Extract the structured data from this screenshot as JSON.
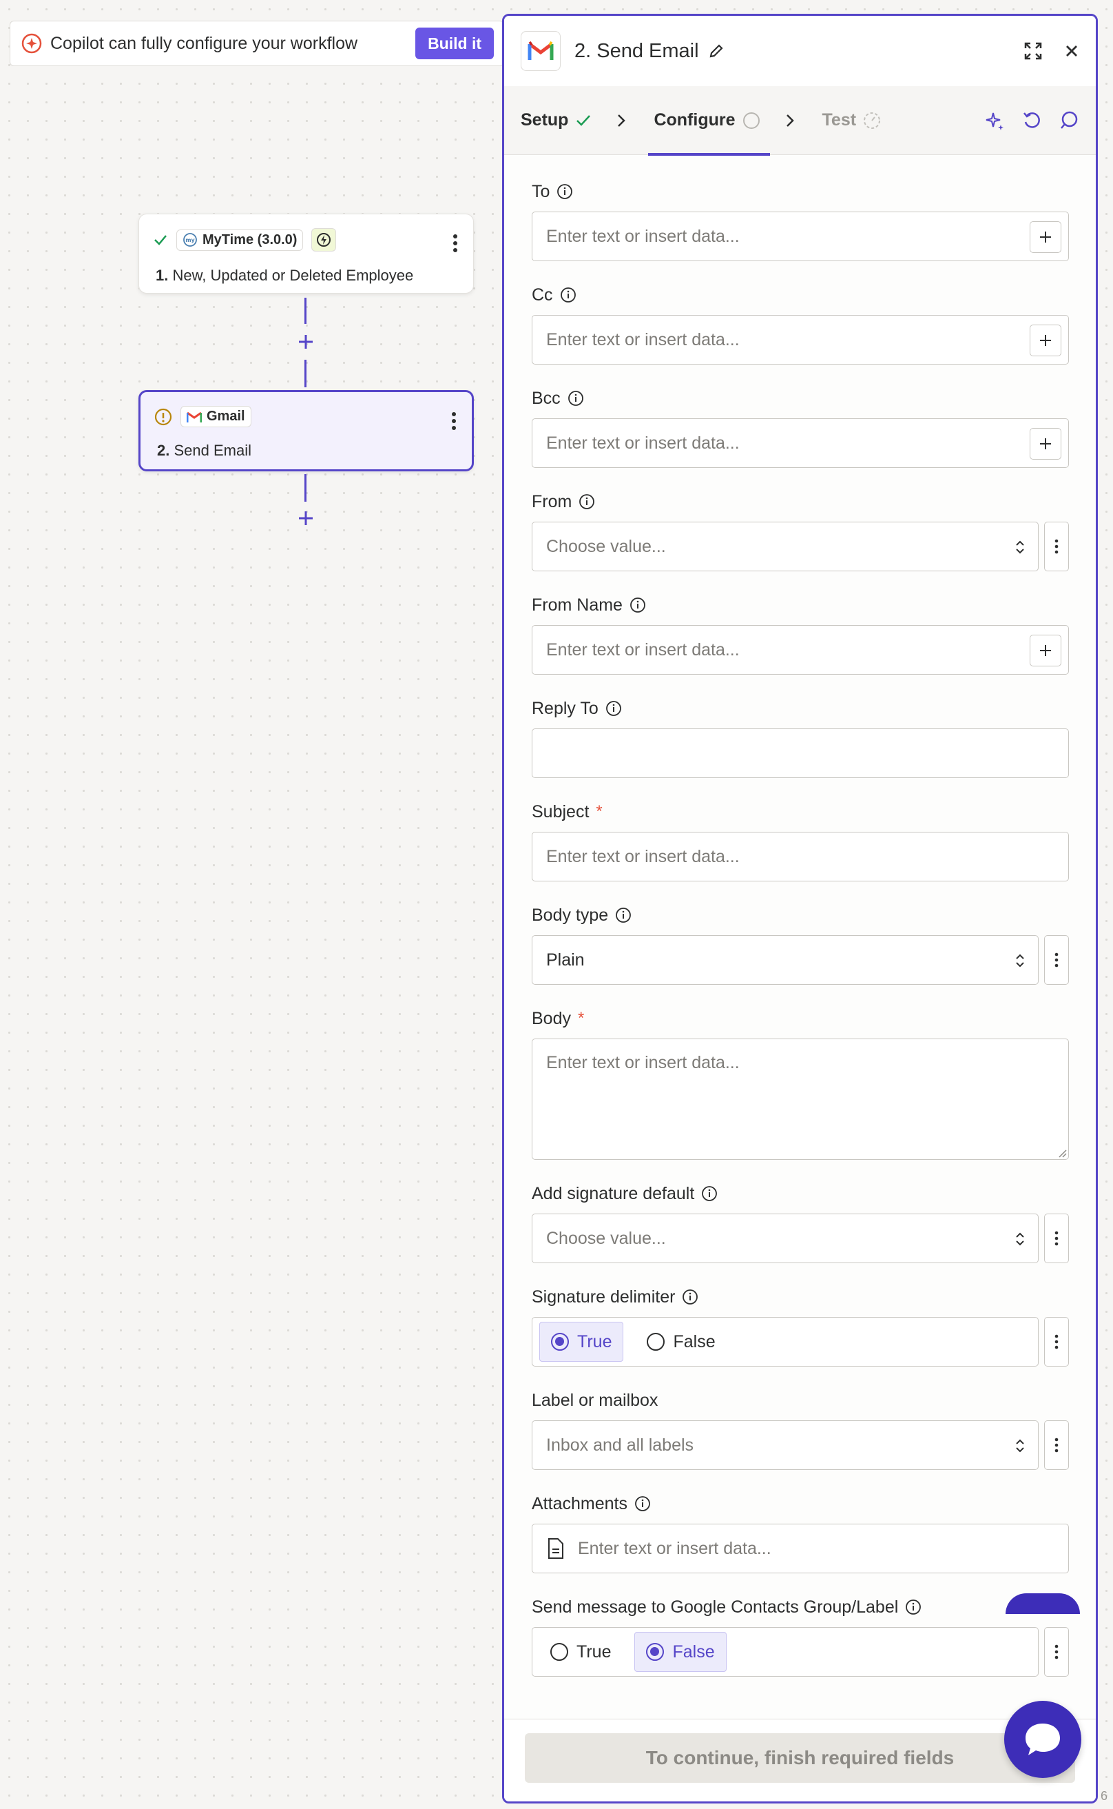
{
  "copilot": {
    "message": "Copilot can fully configure your workflow",
    "build_label": "Build it"
  },
  "canvas": {
    "node1": {
      "app": "MyTime (3.0.0)",
      "step_number": "1.",
      "step_title": "New, Updated or Deleted Employee",
      "status": "complete"
    },
    "node2": {
      "app": "Gmail",
      "step_number": "2.",
      "step_title": "Send Email",
      "status": "warning"
    }
  },
  "panel": {
    "title": "2. Send Email",
    "tabs": [
      {
        "label": "Setup",
        "state": "complete"
      },
      {
        "label": "Configure",
        "state": "active"
      },
      {
        "label": "Test",
        "state": "disabled"
      }
    ],
    "fields": {
      "to": {
        "label": "To",
        "placeholder": "Enter text or insert data..."
      },
      "cc": {
        "label": "Cc",
        "placeholder": "Enter text or insert data..."
      },
      "bcc": {
        "label": "Bcc",
        "placeholder": "Enter text or insert data..."
      },
      "from": {
        "label": "From",
        "placeholder": "Choose value..."
      },
      "from_name": {
        "label": "From Name",
        "placeholder": "Enter text or insert data..."
      },
      "reply_to": {
        "label": "Reply To",
        "placeholder": ""
      },
      "subject": {
        "label": "Subject",
        "required_mark": "*",
        "placeholder": "Enter text or insert data..."
      },
      "body_type": {
        "label": "Body type",
        "value": "Plain"
      },
      "body": {
        "label": "Body",
        "required_mark": "*",
        "placeholder": "Enter text or insert data..."
      },
      "add_signature": {
        "label": "Add signature default",
        "placeholder": "Choose value..."
      },
      "signature_delimiter": {
        "label": "Signature delimiter",
        "options": [
          "True",
          "False"
        ],
        "selected": "True"
      },
      "label_mailbox": {
        "label": "Label or mailbox",
        "placeholder": "Inbox and all labels"
      },
      "attachments": {
        "label": "Attachments",
        "placeholder": "Enter text or insert data..."
      },
      "contacts_group": {
        "label": "Send message to Google Contacts Group/Label",
        "options": [
          "True",
          "False"
        ],
        "selected": "False"
      }
    },
    "continue_label": "To continue, finish required fields"
  },
  "corner_text": "6",
  "colors": {
    "accent": "#5545c8",
    "build_button": "#6956e5",
    "required": "#e5513b",
    "success": "#1a9b52",
    "warning": "#b8860b"
  }
}
